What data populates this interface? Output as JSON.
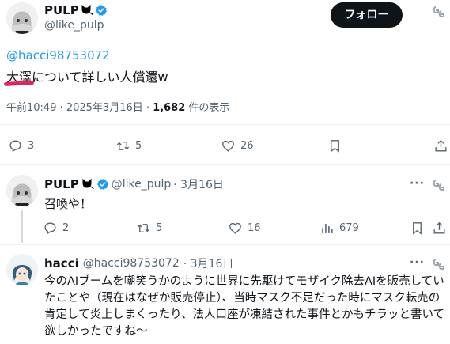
{
  "main_tweet": {
    "author_name": "PULP",
    "author_handle": "@like_pulp",
    "follow_label": "フォロー",
    "reply_to": "@hacci98753072",
    "text": "大澤について詳しい人償還w",
    "timestamp": "午前10:49 · 2025年3月16日 · ",
    "views_count": "1,682",
    "views_label": " 件の表示",
    "stats": {
      "replies": "3",
      "retweets": "5",
      "likes": "26"
    }
  },
  "reply1": {
    "author_name": "PULP",
    "author_handle": "@like_pulp",
    "date": "· 3月16日",
    "text": "召喚や！",
    "stats": {
      "replies": "2",
      "retweets": "5",
      "likes": "16",
      "views": "679"
    }
  },
  "reply2": {
    "author_name": "hacci",
    "author_handle": "@hacci98753072",
    "date": "· 3月16日",
    "text": "今のAIブームを嘲笑うかのように世界に先駆けてモザイク除去AIを販売していたことや（現在はなぜか販売停止）、当時マスク不足だった時にマスク転売の肯定して炎上しまくったり、法人口座が凍結された事件とかもチラッと書いて欲しかったですね～"
  },
  "icons": {
    "more": "more-icon",
    "grok": "grok-icon",
    "verified": "verified-badge-icon",
    "cat": "cat-emoji-icon"
  },
  "colors": {
    "accent": "#1d9bf0",
    "follow_bg": "#0f1419",
    "underline": "#e0245e"
  }
}
